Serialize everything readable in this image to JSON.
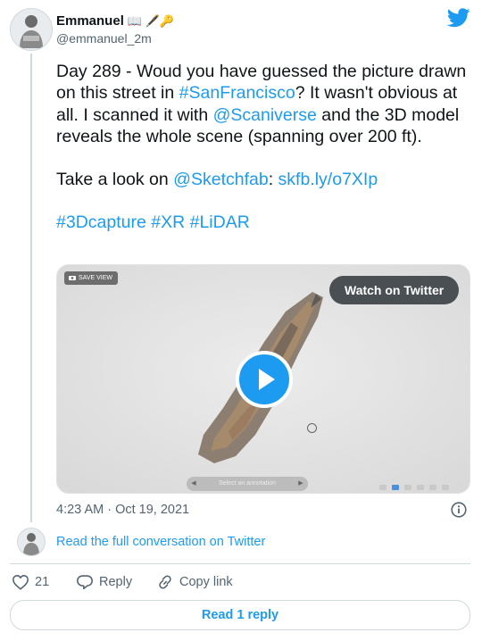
{
  "author": {
    "name": "Emmanuel",
    "emoji": "📖 🖋️🔑",
    "handle": "@emmanuel_2m"
  },
  "tweet": {
    "p1_a": "Day 289 - Woud you have guessed the picture drawn on this street in ",
    "p1_tag": "#SanFrancisco",
    "p1_b": "? It wasn't obvious at all. I scanned it with ",
    "p1_mention": "@Scaniverse",
    "p1_c": " and the 3D model reveals the whole scene (spanning over 200 ft).",
    "p2_a": "Take a look on ",
    "p2_mention": "@Sketchfab",
    "p2_b": ": ",
    "p2_link": "skfb.ly/o7XIp",
    "tags": [
      "#3Dcapture",
      "#XR",
      "#LiDAR"
    ]
  },
  "media": {
    "save_view_label": "SAVE VIEW",
    "watch_label": "Watch on Twitter",
    "annotation_placeholder": "Select an annotation"
  },
  "meta": {
    "timestamp": "4:23 AM · Oct 19, 2021",
    "read_conversation": "Read the full conversation on Twitter"
  },
  "actions": {
    "like_count": "21",
    "reply_label": "Reply",
    "copy_link_label": "Copy link",
    "read_reply_label": "Read 1 reply"
  },
  "colors": {
    "accent": "#1d9bf0",
    "text": "#0f1419",
    "muted": "#536471",
    "border": "#cfd9de"
  },
  "icons": [
    "twitter-bird-icon",
    "camera-icon",
    "play-icon",
    "info-icon",
    "heart-icon",
    "reply-icon",
    "link-icon"
  ]
}
